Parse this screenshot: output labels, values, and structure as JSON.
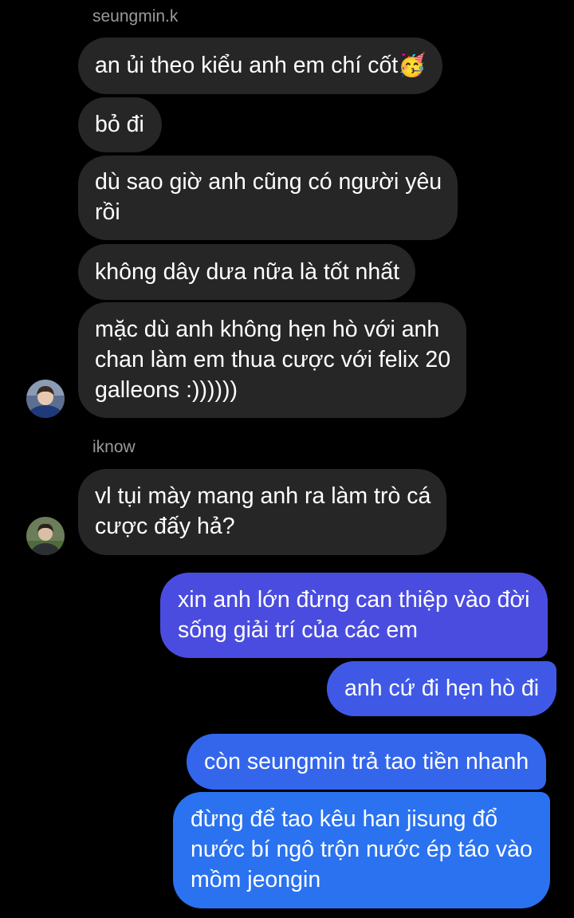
{
  "thread": {
    "group1": {
      "sender": "seungmin.k",
      "messages": [
        {
          "lines": [
            "an ủi theo kiểu anh em chí cốt🥳"
          ]
        },
        {
          "lines": [
            "bỏ đi"
          ]
        },
        {
          "lines": [
            "dù sao giờ anh cũng có người yêu",
            "rồi"
          ]
        },
        {
          "lines": [
            "không dây dưa nữa là tốt nhất"
          ]
        },
        {
          "lines": [
            "mặc dù anh không hẹn hò với anh",
            "chan làm em thua cược với felix 20",
            "galleons :))))))"
          ]
        }
      ],
      "avatar_icon": "user-avatar-icon"
    },
    "group2": {
      "sender": "iknow",
      "messages": [
        {
          "lines": [
            "vl tụi mày mang anh ra làm trò cá",
            "cược đấy hả?"
          ]
        }
      ],
      "avatar_icon": "user-avatar-icon"
    },
    "outgoing": [
      {
        "lines": [
          "xin anh lớn đừng can thiệp vào đời",
          "sống giải trí của các em"
        ],
        "color": "#4a4ce0"
      },
      {
        "lines": [
          "anh cứ đi hẹn hò đi"
        ],
        "color": "#3f59e6"
      },
      {
        "lines": [
          "còn seungmin trả tao tiền nhanh"
        ],
        "color": "#3466ec"
      },
      {
        "lines": [
          "đừng để tao kêu han jisung đổ",
          "nước bí ngô trộn nước ép táo vào",
          "mồm jeongin"
        ],
        "color": "#2a72f0"
      }
    ]
  },
  "colors": {
    "background": "#000000",
    "incoming_bubble": "#262626",
    "sender_name": "#9a9a9a"
  }
}
